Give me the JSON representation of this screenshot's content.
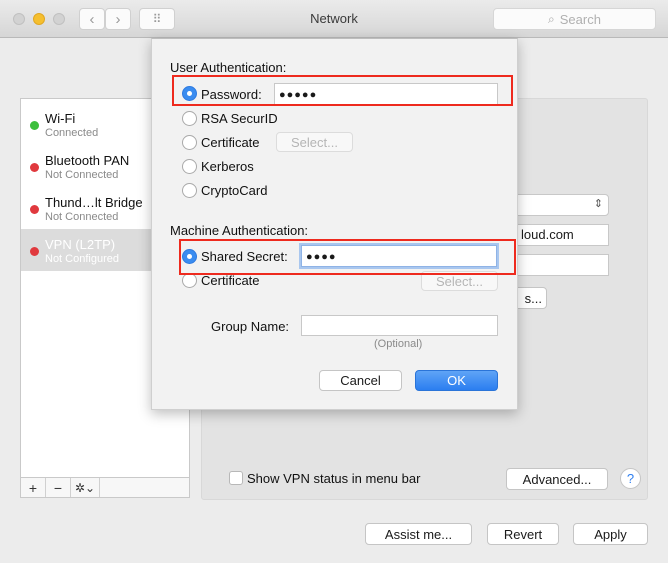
{
  "window": {
    "title": "Network",
    "search_placeholder": "Search",
    "back_label": "‹",
    "forward_label": "›",
    "grid_label": "⠿"
  },
  "sidebar": {
    "services": [
      {
        "name": "Wi-Fi",
        "status": "Connected",
        "status_color": "#3cbf3c",
        "selected": false
      },
      {
        "name": "Bluetooth PAN",
        "status": "Not Connected",
        "status_color": "#e0393e",
        "selected": false
      },
      {
        "name": "Thund…lt Bridge",
        "status": "Not Connected",
        "status_color": "#e0393e",
        "selected": false
      },
      {
        "name": "VPN (L2TP)",
        "status": "Not Configured",
        "status_color": "#e0393e",
        "selected": true
      }
    ],
    "tools": {
      "add": "+",
      "remove": "−",
      "gear": "✲⌄"
    }
  },
  "detail": {
    "server_partial": "loud.com",
    "auth_settings_partial": "s...",
    "show_vpn_status_label": "Show VPN status in menu bar",
    "show_vpn_status_checked": false,
    "advanced_label": "Advanced...",
    "help_label": "?"
  },
  "footer": {
    "assist_label": "Assist me...",
    "revert_label": "Revert",
    "apply_label": "Apply"
  },
  "sheet": {
    "user_auth_label": "User Authentication:",
    "user_options": [
      {
        "label": "Password:",
        "selected": true
      },
      {
        "label": "RSA SecurID",
        "selected": false
      },
      {
        "label": "Certificate",
        "selected": false
      },
      {
        "label": "Kerberos",
        "selected": false
      },
      {
        "label": "CryptoCard",
        "selected": false
      }
    ],
    "password_value": "●●●●●",
    "user_cert_select_label": "Select...",
    "machine_auth_label": "Machine Authentication:",
    "machine_options": [
      {
        "label": "Shared Secret:",
        "selected": true
      },
      {
        "label": "Certificate",
        "selected": false
      }
    ],
    "shared_secret_value": "●●●●",
    "machine_cert_select_label": "Select...",
    "group_name_label": "Group Name:",
    "group_name_value": "",
    "group_name_hint": "(Optional)",
    "cancel_label": "Cancel",
    "ok_label": "OK"
  },
  "annotations": {
    "highlight_color": "#ee2a1e"
  }
}
